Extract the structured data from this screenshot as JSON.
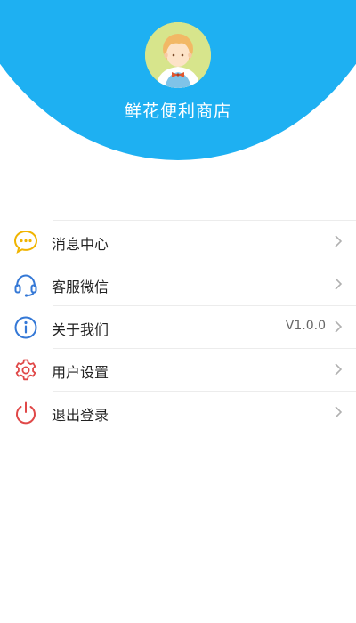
{
  "profile": {
    "store_name": "鲜花便利商店"
  },
  "menu": {
    "items": [
      {
        "label": "消息中心",
        "value": "",
        "icon": "message-icon",
        "color": "#f0b400"
      },
      {
        "label": "客服微信",
        "value": "",
        "icon": "headset-icon",
        "color": "#3478d6"
      },
      {
        "label": "关于我们",
        "value": "V1.0.0",
        "icon": "info-icon",
        "color": "#3478d6"
      },
      {
        "label": "用户设置",
        "value": "",
        "icon": "gear-icon",
        "color": "#e04848"
      },
      {
        "label": "退出登录",
        "value": "",
        "icon": "power-icon",
        "color": "#e04848"
      }
    ]
  },
  "colors": {
    "header_blue": "#1eb0f2",
    "avatar_bg": "#d7e58c"
  }
}
